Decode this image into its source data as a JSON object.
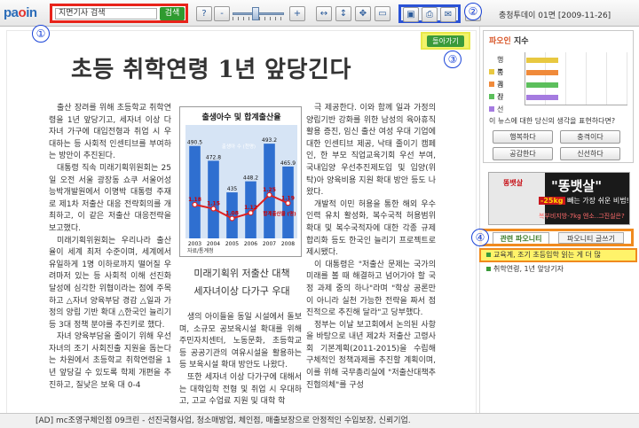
{
  "app": {
    "logo_pa": "pa",
    "logo_o": "o",
    "logo_in": "in"
  },
  "toolbar": {
    "search_value": "지면기사 검색",
    "search_button": "검색",
    "help_label": "?",
    "zoom_out_label": "-",
    "zoom_in_label": "+",
    "issue_info": "충청투데이 01면 [2009-11-26]"
  },
  "annotations": {
    "n1": "①",
    "n2": "②",
    "n3": "③",
    "n4": "④"
  },
  "article": {
    "back_button": "돌아가기",
    "headline": "초등 취학연령 1년 앞당긴다",
    "col1": [
      "출산 장려를 위해 초등학교 취학연령을 1년 앞당기고, 세자녀 이상 다자녀 가구에 대입전형과 취업 시 우대하는 등 사회적 인센티브를 부여하는 방안이 추진된다.",
      "대통령 직속 미래기획위원회는 25일 오전 서울 광장동 쇼쿠 서울어성능박개발원에서 이명박 대통령 주재로 제1차 저출산 대응 전략회의를 개최하고, 이 같은 저출산 대응전략을 보고했다.",
      "미래기획위원회는 우리나라 출산율이 세계 최저 수준이며, 세계에서 유일하게 1명 이하로까지 떨어질 우려마저 있는 등 사회적 이해 선진화 달성에 심각한 위협이라는 점에 주목하고 △자녀 양육부담 경감 △일과 가정의 양립 기반 확대 △한국인 늘리기 등 3대 정책 분야를 추진키로 했다.",
      "자녀 양육부담을 줄이기 위해 우선 자녀의 조기 사회진출 지원을 돕는다는 차원에서 초등학교 취학연령을 1년 앞당길 수 있도록 학제 개편을 추진하고, 질낮은 보육 대 0-4"
    ],
    "col2": [
      "생의 아이들을 동일 시설에서 돌보며, 소규모 공보육시설 확대를 위해 주민자치센터, 노동문화, 초등학교 등 공공기관의 여유시설을 활용하는 등 보육시설 확대 방안도 나왔다.",
      "또한 세자녀 이상 다가구에 대해서는 대학입학 전형 및 취업 시 우대하고, 고교 수업료 지원 및 대학 학"
    ],
    "col3": [
      "극 제공한다. 이와 함께 일과 가정의 양립기반 강화를 위한 남성의 육아휴직 활용 증진, 임신 출산 여성 우대 기업에 대한 인센티브 제공, 낙태 줄이기 캠페인, 한 부모 직업교육기회 우선 부여, 국내입양 우선추진제도입 및 입양(위탁)아 양육비용 지원 확대 방안 등도 나왔다.",
      "개발적 이민 허용을 통한 해외 우수인력 유치 활성화, 복수국적 허용범위 확대 및 복수국적자에 대한 각종 규제 합리화 등도 한국인 늘리기 프로젝트로 제시됐다.",
      "이 대통령은 \"저출산 문제는 국가의 미래를 볼 때 해결하고 넘어가야 할 국정 과제 중의 하나\"라며 \"학상 공론만이 아니라 실천 가능한 전략을 짜서 점진적으로 추진해 달라\"고 당부했다.",
      "정부는 이날 보고회에서 논의된 사항을 바탕으로 내년 제2차 저출산 고령사회 기본계획(2011-2015)을 수립해 구체적인 정책과제를 추진할 계획이며, 이를 위해 국무총리실에 \"저출산대책추진협의체\"를 구성"
    ],
    "sub1": "미래기획위 저출산 대책",
    "sub2": "세자녀이상 다가구 우대"
  },
  "chart_data": {
    "type": "bar",
    "title": "출생아수 및 합계출산율",
    "categories": [
      "2003",
      "2004",
      "2005",
      "2006",
      "2007",
      "2008"
    ],
    "series": [
      {
        "name": "출생아 수 (천명)",
        "values": [
          490.5,
          472.8,
          435,
          448.2,
          493.2,
          465.9
        ]
      },
      {
        "name": "합계출산율 (명)",
        "values": [
          1.18,
          1.15,
          1.08,
          1.12,
          1.25,
          1.19
        ]
      }
    ],
    "source": "자료/통계청",
    "colors": {
      "bar": "#2f6fd0",
      "line": "#e02020"
    }
  },
  "sidebar": {
    "title_accent": "파오인",
    "title_rest": " 지수",
    "legend": [
      {
        "label": "행복",
        "color": "#e8c840",
        "value": 0
      },
      {
        "label": "충격",
        "color": "#f08a3a",
        "value": 0
      },
      {
        "label": "공감",
        "color": "#5cbf5c",
        "value": 0
      },
      {
        "label": "신선",
        "color": "#a57be0",
        "value": 0
      }
    ],
    "question": "이 뉴스에 대한 당신의 생각을 표현하다면?",
    "reactions": [
      "행복하다",
      "충격이다",
      "공감한다",
      "신선하다"
    ],
    "ad": {
      "mn": "똥뱃살",
      "big": "\"똥뱃살\"",
      "mid_b": "-25kg",
      "mid": " 빼는 가장 쉬운 비법!!",
      "sml": "복부비지방-7kg 엔소..그진실은?"
    },
    "tabs": [
      "관련 파오니티",
      "파오니티 글쓰기"
    ],
    "related": [
      "교육계, 조기 초등입학 읽는 게 더 많",
      "취학연령, 1년 앞당기자"
    ]
  },
  "footer": {
    "ad_text": "[AD] mc조영구체인점 09크린 - 선진국형사업, 청소매방업, 체인점, 매출보장으로 안정적인 수입보장, 신뢰기업."
  }
}
